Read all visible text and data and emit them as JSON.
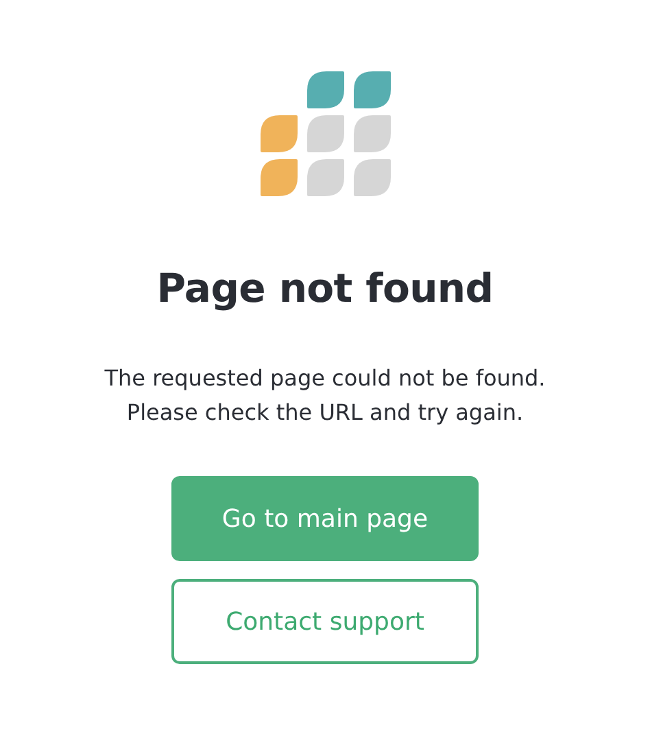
{
  "title": "Page not found",
  "message": "The requested page could not be found. Please check the URL and try again.",
  "buttons": [
    {
      "label": "Go to main page",
      "kind": "primary"
    },
    {
      "label": "Contact support",
      "kind": "secondary"
    }
  ]
}
